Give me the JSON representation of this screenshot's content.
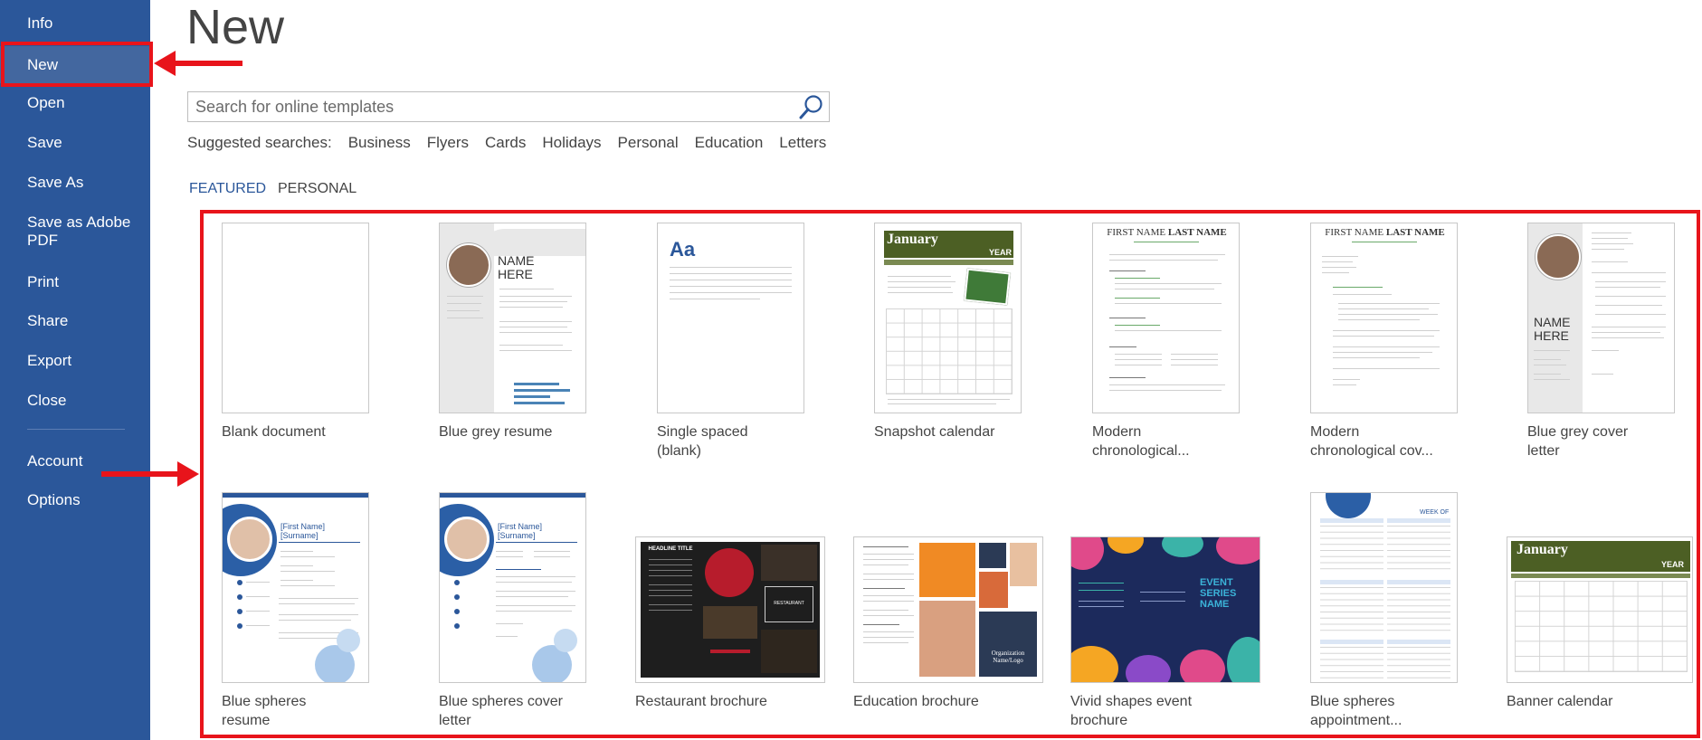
{
  "sidebar": {
    "items": [
      {
        "label": "Info"
      },
      {
        "label": "New"
      },
      {
        "label": "Open"
      },
      {
        "label": "Save"
      },
      {
        "label": "Save As"
      },
      {
        "label": "Save as Adobe",
        "label2": "PDF"
      },
      {
        "label": "Print"
      },
      {
        "label": "Share"
      },
      {
        "label": "Export"
      },
      {
        "label": "Close"
      },
      {
        "label": "Account"
      },
      {
        "label": "Options"
      }
    ]
  },
  "page": {
    "title": "New"
  },
  "search": {
    "placeholder": "Search for online templates"
  },
  "suggested": {
    "label": "Suggested searches:",
    "items": [
      "Business",
      "Flyers",
      "Cards",
      "Holidays",
      "Personal",
      "Education",
      "Letters"
    ]
  },
  "tabs": {
    "featured": "FEATURED",
    "personal": "PERSONAL"
  },
  "templates": [
    {
      "line1": "Blank document",
      "line2": ""
    },
    {
      "line1": "Blue grey resume",
      "line2": ""
    },
    {
      "line1": "Single spaced",
      "line2": "(blank)"
    },
    {
      "line1": "Snapshot calendar",
      "line2": ""
    },
    {
      "line1": "Modern",
      "line2": "chronological..."
    },
    {
      "line1": "Modern",
      "line2": "chronological cov..."
    },
    {
      "line1": "Blue grey cover",
      "line2": "letter"
    },
    {
      "line1": "Blue spheres",
      "line2": "resume"
    },
    {
      "line1": "Blue spheres cover",
      "line2": "letter"
    },
    {
      "line1": "Restaurant brochure",
      "line2": ""
    },
    {
      "line1": "Education brochure",
      "line2": ""
    },
    {
      "line1": "Vivid shapes event",
      "line2": "brochure"
    },
    {
      "line1": "Blue spheres",
      "line2": "appointment..."
    },
    {
      "line1": "Banner calendar",
      "line2": ""
    }
  ],
  "thumb_text": {
    "single_aa": "Aa",
    "calendar_month": "January",
    "calendar_year": "YEAR",
    "resume_name": "NAME",
    "resume_name2": "HERE",
    "resume_first": "FIRST NAME",
    "resume_last": "LAST NAME",
    "spheres_name": "[First Name]",
    "spheres_surname": "[Surname]",
    "restaurant_title": "HEADLINE TITLE",
    "restaurant_word": "RESTAURANT",
    "vivid_event": "EVENT",
    "vivid_series": "SERIES",
    "vivid_name": "NAME",
    "edu_org": "Organization",
    "edu_logo": "Name/Logo",
    "appt_week": "WEEK OF"
  },
  "colors": {
    "sidebar": "#2b579a",
    "accent": "#2b579a",
    "highlight": "#e8141b"
  }
}
